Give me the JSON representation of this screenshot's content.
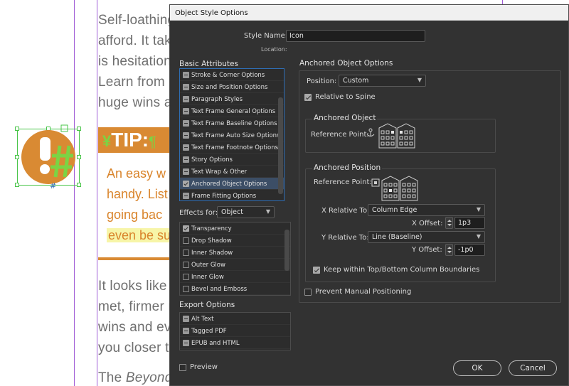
{
  "document": {
    "body_lines": [
      "Self-loathing",
      "afford. It tak",
      "is hesitation",
      "Learn from",
      "huge wins a"
    ],
    "tip_symbol": "¥",
    "tip_label": "TIP:",
    "tip_pilcrow": "¶",
    "orange_lines": [
      "An easy w",
      "handy. List",
      "going bac",
      "even be su"
    ],
    "lower_lines": [
      "It looks like",
      "met, firmer r",
      "wins and ev",
      "you closer t"
    ],
    "last_line_prefix": "The ",
    "last_line_italic": "Beyond",
    "frame_marker": "#"
  },
  "dialog": {
    "title": "Object Style Options",
    "style_name_label": "Style Name:",
    "style_name_value": "Icon",
    "location_label": "Location:",
    "basic_attributes_title": "Basic Attributes",
    "basic_items": [
      {
        "label": "Stroke & Corner Options",
        "state": "minus"
      },
      {
        "label": "Size and Position Options",
        "state": "minus"
      },
      {
        "label": "Paragraph Styles",
        "state": "minus"
      },
      {
        "label": "Text Frame General Options",
        "state": "minus"
      },
      {
        "label": "Text Frame Baseline Options",
        "state": "minus"
      },
      {
        "label": "Text Frame Auto Size Options",
        "state": "minus"
      },
      {
        "label": "Text Frame Footnote Options",
        "state": "minus"
      },
      {
        "label": "Story Options",
        "state": "minus"
      },
      {
        "label": "Text Wrap & Other",
        "state": "minus"
      },
      {
        "label": "Anchored Object Options",
        "state": "checked",
        "selected": true
      },
      {
        "label": "Frame Fitting Options",
        "state": "minus"
      }
    ],
    "effects_for_label": "Effects for:",
    "effects_for_value": "Object",
    "effect_items": [
      {
        "label": "Transparency",
        "state": "checked"
      },
      {
        "label": "Drop Shadow",
        "state": "empty"
      },
      {
        "label": "Inner Shadow",
        "state": "empty"
      },
      {
        "label": "Outer Glow",
        "state": "empty"
      },
      {
        "label": "Inner Glow",
        "state": "empty"
      },
      {
        "label": "Bevel and Emboss",
        "state": "empty"
      }
    ],
    "export_options_title": "Export Options",
    "export_items": [
      {
        "label": "Alt Text",
        "state": "minus"
      },
      {
        "label": "Tagged PDF",
        "state": "minus"
      },
      {
        "label": "EPUB and HTML",
        "state": "minus"
      }
    ],
    "preview_label": "Preview",
    "preview_checked": false,
    "panel_title": "Anchored Object Options",
    "position_label": "Position:",
    "position_value": "Custom",
    "relative_to_spine_label": "Relative to Spine",
    "relative_to_spine_checked": true,
    "anchored_object_title": "Anchored Object",
    "reference_point_label": "Reference Point:",
    "anchored_position_title": "Anchored Position",
    "x_relative_label": "X Relative To:",
    "x_relative_value": "Column Edge",
    "x_offset_label": "X Offset:",
    "x_offset_value": "1p3",
    "y_relative_label": "Y Relative To:",
    "y_relative_value": "Line (Baseline)",
    "y_offset_label": "Y Offset:",
    "y_offset_value": "-1p0",
    "keep_within_label": "Keep within Top/Bottom Column Boundaries",
    "keep_within_checked": true,
    "prevent_manual_label": "Prevent Manual Positioning",
    "prevent_manual_checked": false,
    "ok_label": "OK",
    "cancel_label": "Cancel"
  },
  "colors": {
    "dialog_bg": "#323232",
    "accent_selection": "#3c4e66",
    "page_orange": "#d98a33",
    "page_green": "#7bd444",
    "guide_purple": "#a05bd6"
  }
}
